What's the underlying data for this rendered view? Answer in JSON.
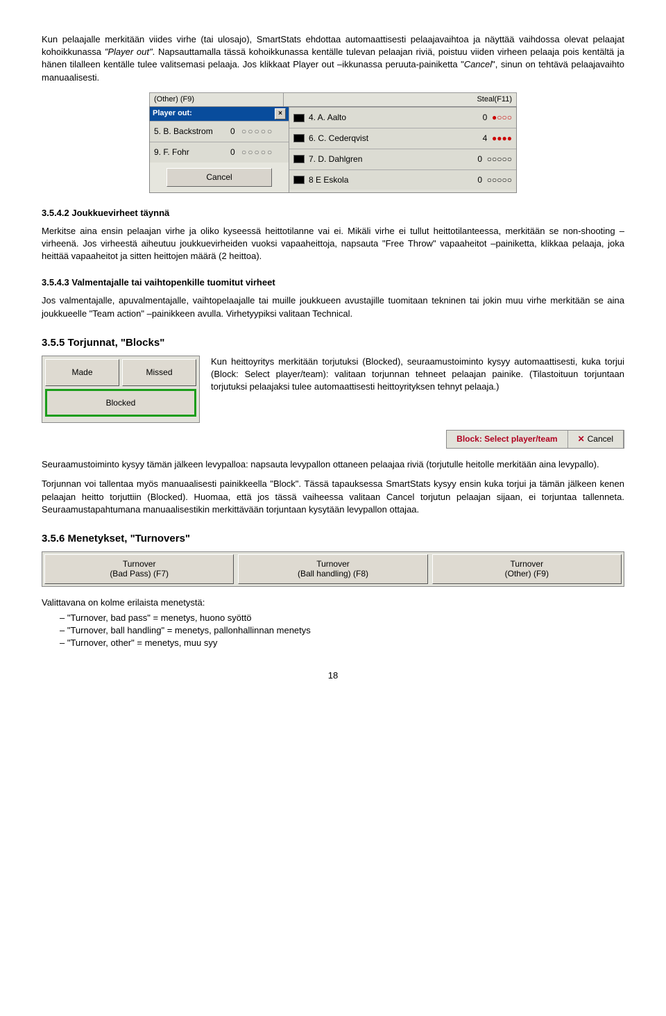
{
  "intro": {
    "p1a": "Kun pelaajalle merkitään viides virhe (tai ulosajo), SmartStats ehdottaa automaattisesti pelaajavaihtoa ja näyttää vaihdossa olevat pelaajat kohoikkunassa ",
    "p1b": "\"Player out\"",
    "p1c": ". Napsauttamalla tässä kohoikkunassa kentälle tulevan pelaajan riviä, poistuu viiden virheen pelaaja pois kentältä ja hänen tilalleen kentälle tulee valitsemasi pelaaja. Jos klikkaat Player out –ikkunassa peruuta-painiketta \"",
    "p1d": "Cancel",
    "p1e": "\", sinun on tehtävä pelaajavaihto manuaalisesti."
  },
  "playerout": {
    "topLeft": "(Other) (F9)",
    "topRight": "Steal(F11)",
    "title": "Player out:",
    "leftRows": [
      {
        "name": "5. B. Backstrom",
        "val": "0",
        "circ": "○○○○○"
      },
      {
        "name": "9. F. Fohr",
        "val": "0",
        "circ": "○○○○○"
      }
    ],
    "cancel": "Cancel",
    "rightRows": [
      {
        "name": "4. A. Aalto",
        "val": "0",
        "dots": "●○○○",
        "red": true
      },
      {
        "name": "6. C. Cederqvist",
        "val": "4",
        "dots": "●●●●",
        "red": true
      },
      {
        "name": "7. D. Dahlgren",
        "val": "0",
        "dots": "○○○○○",
        "red": false
      },
      {
        "name": "8  E  Eskola",
        "val": "0",
        "dots": "○○○○○",
        "red": false
      }
    ]
  },
  "sec3542": {
    "title": "3.5.4.2 Joukkuevirheet täynnä",
    "p": "Merkitse aina ensin pelaajan virhe ja oliko kyseessä heittotilanne vai ei. Mikäli virhe ei tullut heittotilanteessa, merkitään se non-shooting –virheenä. Jos virheestä aiheutuu joukkuevirheiden vuoksi vapaaheittoja, napsauta \"Free Throw\" vapaaheitot –painiketta, klikkaa pelaaja, joka heittää vapaaheitot ja sitten heittojen määrä (2 heittoa)."
  },
  "sec3543": {
    "title": "3.5.4.3 Valmentajalle tai vaihtopenkille tuomitut virheet",
    "p": "Jos valmentajalle, apuvalmentajalle, vaihtopelaajalle tai muille joukkueen avustajille tuomitaan tekninen tai jokin muu virhe merkitään se aina joukkueelle \"Team action\" –painikkeen avulla. Virhetyypiksi valitaan Technical."
  },
  "sec355": {
    "title": "3.5.5   Torjunnat, \"Blocks\"",
    "shot": {
      "made": "Made",
      "missed": "Missed",
      "blocked": "Blocked"
    },
    "p": "Kun heittoyritys merkitään torjutuksi (Blocked), seuraamustoiminto kysyy automaattisesti, kuka torjui (Block: Select player/team): valitaan torjunnan tehneet pelaajan painike. (Tilastoituun torjuntaan torjutuksi pelaajaksi tulee automaattisesti heittoyrityksen tehnyt pelaaja.)",
    "blockbar": {
      "label": "Block: Select player/team",
      "cancel": "Cancel"
    },
    "p2": "Seuraamustoiminto kysyy tämän jälkeen levypalloa: napsauta levypallon ottaneen pelaajaa riviä (torjutulle heitolle merkitään aina levypallo).",
    "p3": "Torjunnan voi tallentaa myös manuaalisesti painikkeella \"Block\". Tässä tapauksessa SmartStats kysyy ensin kuka torjui ja tämän jälkeen kenen pelaajan heitto torjuttiin (Blocked). Huomaa, että jos tässä vaiheessa valitaan Cancel torjutun pelaajan sijaan, ei torjuntaa tallenneta. Seuraamustapahtumana manuaalisestikin merkittävään torjuntaan kysytään levypallon ottajaa."
  },
  "sec356": {
    "title": "3.5.6   Menetykset, \"Turnovers\"",
    "buttons": {
      "bp": "Turnover\n(Bad Pass) (F7)",
      "bh": "Turnover\n(Ball handling) (F8)",
      "ot": "Turnover\n(Other) (F9)"
    },
    "listTitle": "Valittavana on kolme erilaista menetystä:",
    "items": [
      "\"Turnover, bad pass\" = menetys, huono syöttö",
      "\"Turnover, ball handling\" = menetys, pallonhallinnan menetys",
      "\"Turnover, other\" = menetys, muu syy"
    ]
  },
  "pageNum": "18"
}
